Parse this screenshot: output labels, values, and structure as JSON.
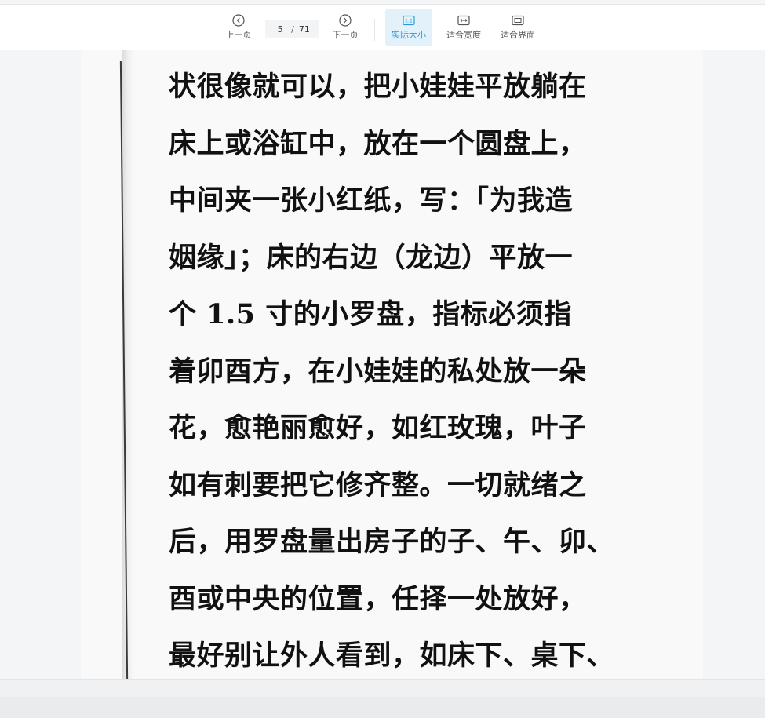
{
  "toolbar": {
    "prev_label": "上一页",
    "next_label": "下一页",
    "current_page": "5",
    "separator": "/",
    "total_pages": "71",
    "actual_size_label": "实际大小",
    "fit_width_label": "适合宽度",
    "fit_screen_label": "适合界面",
    "active_mode": "actual_size",
    "accent_color": "#2a9bd8"
  },
  "document": {
    "lines": [
      "状很像就可以，把小娃娃平放躺在",
      "床上或浴缸中，放在一个圆盘上，",
      "中间夹一张小红纸，写：「为我造",
      "姻缘」；床的右边（龙边）平放一",
      "个 1.5 寸的小罗盘，指标必须指",
      "着卯酉方，在小娃娃的私处放一朵",
      "花，愈艳丽愈好，如红玫瑰，叶子",
      "如有刺要把它修齐整。一切就绪之",
      "后，用罗盘量出房子的子、午、卯、",
      "酉或中央的位置，任择一处放好，",
      "最好别让外人看到，如床下、桌下、"
    ]
  }
}
